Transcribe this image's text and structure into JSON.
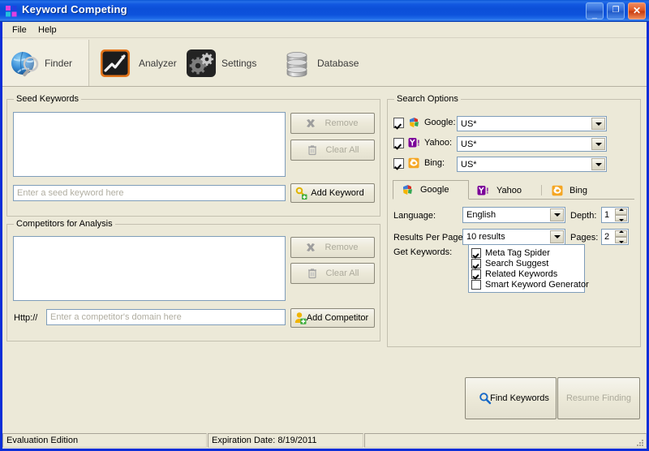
{
  "window": {
    "title": "Keyword Competing",
    "icon": "app-grid-icon",
    "buttons": {
      "minimize": "minimize-icon",
      "maximize": "maximize-icon",
      "close": "close-icon"
    }
  },
  "menu": {
    "items": [
      {
        "label": "File"
      },
      {
        "label": "Help"
      }
    ]
  },
  "toolbar": {
    "items": [
      {
        "label": "Finder",
        "icon": "globe-magnifier-icon",
        "active": true
      },
      {
        "label": "Analyzer",
        "icon": "chart-trend-icon",
        "active": false
      },
      {
        "label": "Settings",
        "icon": "gears-icon",
        "active": false
      },
      {
        "label": "Database",
        "icon": "database-cylinder-icon",
        "active": false
      }
    ]
  },
  "seed_keywords": {
    "group_title": "Seed Keywords",
    "list_items": [],
    "input_placeholder": "Enter a seed keyword here",
    "input_value": "",
    "remove_label": "Remove",
    "remove_icon": "x-mark-icon",
    "remove_disabled": true,
    "clear_all_label": "Clear All",
    "clear_all_icon": "trash-icon",
    "clear_all_disabled": true,
    "add_label": "Add Keyword",
    "add_icon": "key-add-icon"
  },
  "competitors": {
    "group_title": "Competitors for Analysis",
    "list_items": [],
    "protocol_label": "Http://",
    "input_placeholder": "Enter a competitor's domain here",
    "input_value": "",
    "remove_label": "Remove",
    "remove_icon": "x-mark-icon",
    "remove_disabled": true,
    "clear_all_label": "Clear All",
    "clear_all_icon": "trash-icon",
    "clear_all_disabled": true,
    "add_label": "Add Competitor",
    "add_icon": "user-add-icon"
  },
  "search_options": {
    "group_title": "Search Options",
    "engines": [
      {
        "label": "Google:",
        "icon": "google-g-icon",
        "checked": true,
        "region": "US*"
      },
      {
        "label": "Yahoo:",
        "icon": "yahoo-y-icon",
        "checked": true,
        "region": "US*"
      },
      {
        "label": "Bing:",
        "icon": "bing-b-icon",
        "checked": true,
        "region": "US*"
      }
    ],
    "tabs": [
      {
        "label": "Google",
        "icon": "google-g-icon",
        "selected": true
      },
      {
        "label": "Yahoo",
        "icon": "yahoo-y-icon",
        "selected": false
      },
      {
        "label": "Bing",
        "icon": "bing-b-icon",
        "selected": false
      }
    ],
    "language_label": "Language:",
    "language_value": "English",
    "depth_label": "Depth:",
    "depth_value": "1",
    "results_per_page_label": "Results Per Page:",
    "results_per_page_value": "10 results",
    "pages_label": "Pages:",
    "pages_value": "2",
    "get_keywords_label": "Get Keywords:",
    "get_keywords_options": [
      {
        "label": "Meta Tag Spider",
        "checked": true
      },
      {
        "label": "Search Suggest",
        "checked": true
      },
      {
        "label": "Related Keywords",
        "checked": true
      },
      {
        "label": "Smart Keyword Generator",
        "checked": false
      }
    ]
  },
  "actions": {
    "find_label": "Find Keywords",
    "find_icon": "magnifier-icon",
    "resume_label": "Resume Finding",
    "resume_disabled": true
  },
  "status": {
    "edition": "Evaluation Edition",
    "expiration": "Expiration Date: 8/19/2011",
    "extra": ""
  },
  "colors": {
    "titlebar_blue": "#0c4fd8",
    "window_bg": "#ece9d8",
    "field_border": "#7f9db9",
    "google_blue": "#3b7dd8",
    "google_red": "#d93025",
    "google_yellow": "#f4b400",
    "google_green": "#34a853",
    "yahoo_purple": "#7b0099",
    "bing_orange": "#f5a623",
    "analyzer_orange": "#e2741a"
  }
}
